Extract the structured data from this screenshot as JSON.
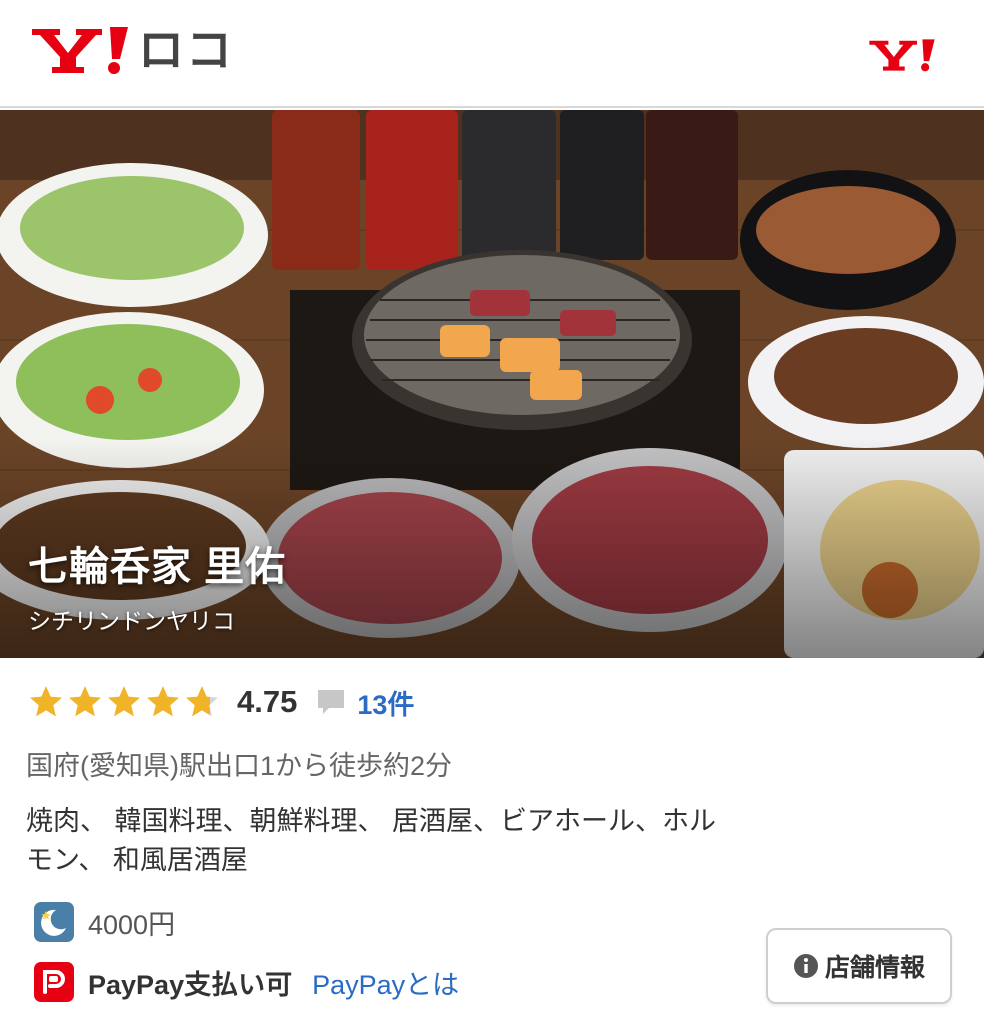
{
  "header": {
    "logo_text": "ロコ",
    "brand_color": "#e60012"
  },
  "shop": {
    "name": "七輪呑家 里佑",
    "kana": "シチリンドンヤリコ",
    "rating": "4.75",
    "rating_value": 4.75,
    "review_count": "13件",
    "access": "国府(愛知県)駅出口1から徒歩約2分",
    "genres": "焼肉、 韓国料理、朝鮮料理、 居酒屋、ビアホール、ホルモン、 和風居酒屋",
    "budget": "4000円",
    "paypay_label": "PayPay支払い可",
    "paypay_link": "PayPayとは"
  },
  "buttons": {
    "info_label": "店舗情報"
  },
  "icons": {
    "logo": "yahoo-logo-icon",
    "header_right": "yahoo-small-icon",
    "star": "star-icon",
    "comment": "comment-icon",
    "budget": "moon-icon",
    "paypay": "paypay-icon",
    "info": "info-icon"
  },
  "colors": {
    "star": "#f0b429",
    "link": "#2a6bc4",
    "paypay": "#e60012"
  }
}
